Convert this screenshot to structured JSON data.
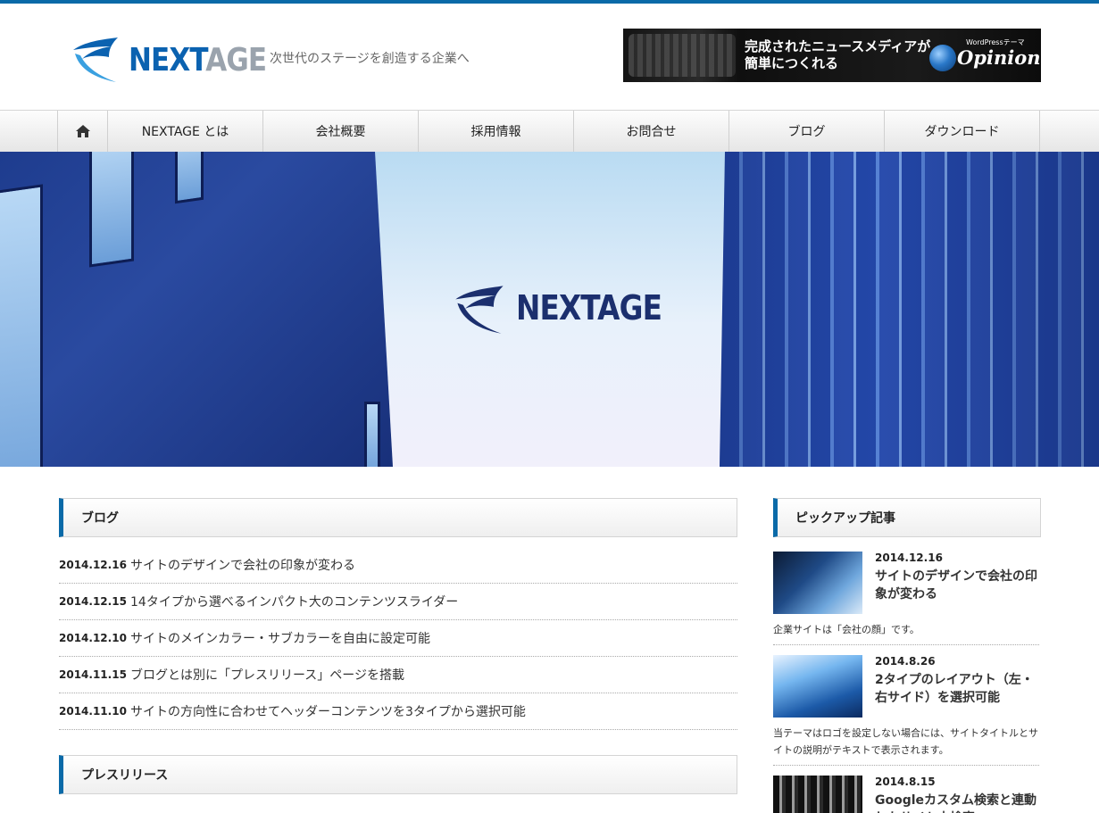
{
  "header": {
    "logo_next": "NEXT",
    "logo_age": "AGE",
    "tagline": "次世代のステージを創造する企業へ",
    "banner": {
      "headline_line1": "完成されたニュースメディアが",
      "headline_line2": "簡単につくれる",
      "wp_label": "WordPressテーマ",
      "product": "Opinion"
    }
  },
  "nav": {
    "home_icon": "home-icon",
    "items": [
      "NEXTAGE とは",
      "会社概要",
      "採用情報",
      "お問合せ",
      "ブログ",
      "ダウンロード"
    ]
  },
  "hero": {
    "logo_text": "NEXTAGE"
  },
  "blog": {
    "heading": "ブログ",
    "posts": [
      {
        "date": "2014.12.16",
        "title": "サイトのデザインで会社の印象が変わる"
      },
      {
        "date": "2014.12.15",
        "title": "14タイプから選べるインパクト大のコンテンツスライダー"
      },
      {
        "date": "2014.12.10",
        "title": "サイトのメインカラー・サブカラーを自由に設定可能"
      },
      {
        "date": "2014.11.15",
        "title": "ブログとは別に「プレスリリース」ページを搭載"
      },
      {
        "date": "2014.11.10",
        "title": "サイトの方向性に合わせてヘッダーコンテンツを3タイプから選択可能"
      }
    ]
  },
  "press": {
    "heading": "プレスリリース"
  },
  "pickup": {
    "heading": "ピックアップ記事",
    "articles": [
      {
        "date": "2014.12.16",
        "title": "サイトのデザインで会社の印象が変わる",
        "excerpt": "企業サイトは「会社の顔」です。"
      },
      {
        "date": "2014.8.26",
        "title": "2タイプのレイアウト（左・右サイド）を選択可能",
        "excerpt": "当テーマはロゴを設定しない場合には、サイトタイトルとサイトの説明がテキストで表示されます。"
      },
      {
        "date": "2014.8.15",
        "title": "Googleカスタム検索と連動したサイト内検索",
        "excerpt": ""
      }
    ]
  },
  "colors": {
    "accent": "#0a6aa8",
    "logo_blue": "#0b62b0",
    "logo_gray": "#9aa3ad"
  }
}
